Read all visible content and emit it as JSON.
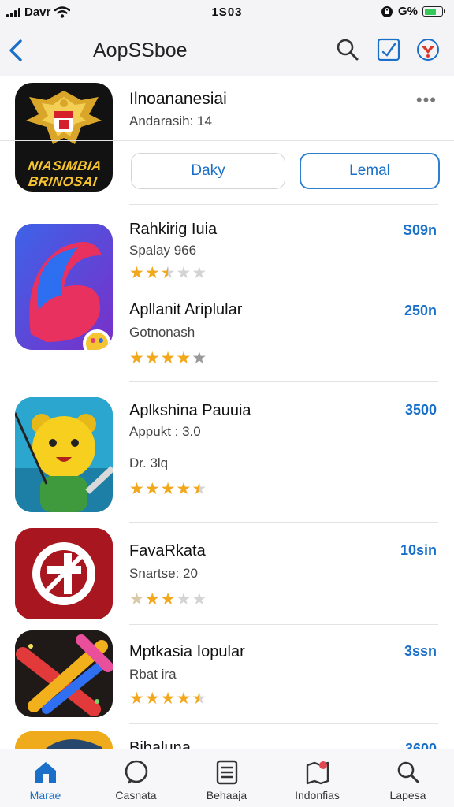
{
  "status_bar": {
    "carrier": "Davr",
    "time": "1S03",
    "battery_text": "G%"
  },
  "nav": {
    "title": "AopSSboe"
  },
  "header_app": {
    "name": "Ilnoananesiai",
    "subtitle": "Andarasih: 14",
    "icon_text_line1": "NIASIMBIA",
    "icon_text_line2": "BRINOSAI",
    "button_left": "Daky",
    "button_right": "Lemal",
    "more": "•••"
  },
  "apps": [
    {
      "title": "Rahkirig Iuia",
      "subtitle": "Spalay 966",
      "rating": 2.5,
      "price": "S09n",
      "second_title": "Apllanit Ariplular",
      "second_subtitle": "Gotnonash",
      "second_rating": 4,
      "second_price": "250n"
    },
    {
      "title": "Aplkshina Pauuia",
      "subtitle": "Appukt : 3.0",
      "extra_line": "Dr. 3lq",
      "rating": 4.5,
      "price": "3500"
    },
    {
      "title": "FavaRkata",
      "subtitle": "Snartse: 20",
      "rating": 3,
      "price": "10sin"
    },
    {
      "title": "Mptkasia Iopular",
      "subtitle": "Rbat ira",
      "rating": 4.5,
      "price": "3ssn"
    },
    {
      "title": "Bibaluna",
      "price": "3600"
    }
  ],
  "tabs": [
    {
      "label": "Marae",
      "icon": "home-icon"
    },
    {
      "label": "Casnata",
      "icon": "chat-icon"
    },
    {
      "label": "Behaaja",
      "icon": "list-icon"
    },
    {
      "label": "Indonfias",
      "icon": "map-icon"
    },
    {
      "label": "Lapesa",
      "icon": "search-icon"
    }
  ],
  "colors": {
    "accent": "#1a6fc9",
    "star": "#f2a81d",
    "star_off": "#d4d4d6"
  }
}
